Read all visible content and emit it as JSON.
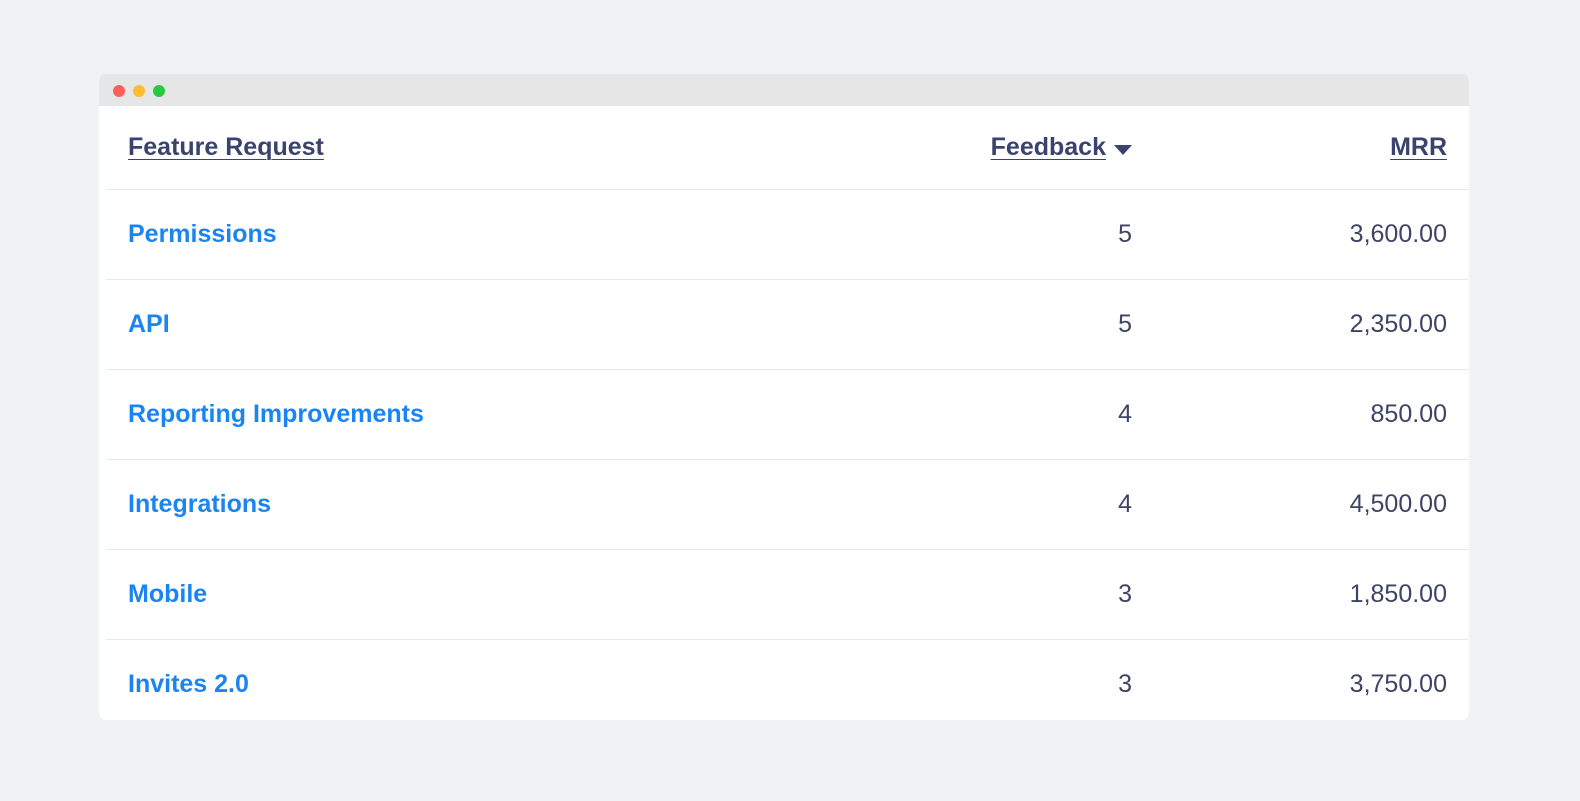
{
  "window": {
    "traffic_lights": [
      "close",
      "minimize",
      "maximize"
    ]
  },
  "table": {
    "headers": {
      "name": "Feature Request",
      "feedback": "Feedback",
      "mrr": "MRR"
    },
    "sort": {
      "column": "feedback",
      "direction": "descending",
      "icon": "caret-down-icon"
    },
    "rows": [
      {
        "name": "Permissions",
        "feedback": "5",
        "mrr": "3,600.00"
      },
      {
        "name": "API",
        "feedback": "5",
        "mrr": "2,350.00"
      },
      {
        "name": "Reporting Improvements",
        "feedback": "4",
        "mrr": "850.00"
      },
      {
        "name": "Integrations",
        "feedback": "4",
        "mrr": "4,500.00"
      },
      {
        "name": "Mobile",
        "feedback": "3",
        "mrr": "1,850.00"
      },
      {
        "name": "Invites 2.0",
        "feedback": "3",
        "mrr": "3,750.00"
      }
    ]
  },
  "colors": {
    "background": "#eff3f6",
    "link": "#1a85f0",
    "header_text": "#3a4370",
    "value_text": "#3d4464",
    "divider": "#e6e8eb"
  }
}
